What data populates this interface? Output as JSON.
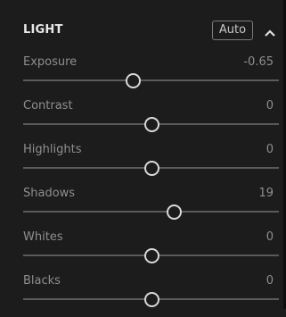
{
  "panel": {
    "title": "LIGHT",
    "auto_label": "Auto",
    "collapse_icon": "chevron-up-icon"
  },
  "sliders": [
    {
      "label": "Exposure",
      "value": "-0.65",
      "position": 0.43
    },
    {
      "label": "Contrast",
      "value": "0",
      "position": 0.5
    },
    {
      "label": "Highlights",
      "value": "0",
      "position": 0.5
    },
    {
      "label": "Shadows",
      "value": "19",
      "position": 0.59
    },
    {
      "label": "Whites",
      "value": "0",
      "position": 0.5
    },
    {
      "label": "Blacks",
      "value": "0",
      "position": 0.5
    }
  ],
  "colors": {
    "background": "#1c1c1c",
    "track": "#5a5a5a",
    "thumb_border": "#d8d8d8"
  }
}
